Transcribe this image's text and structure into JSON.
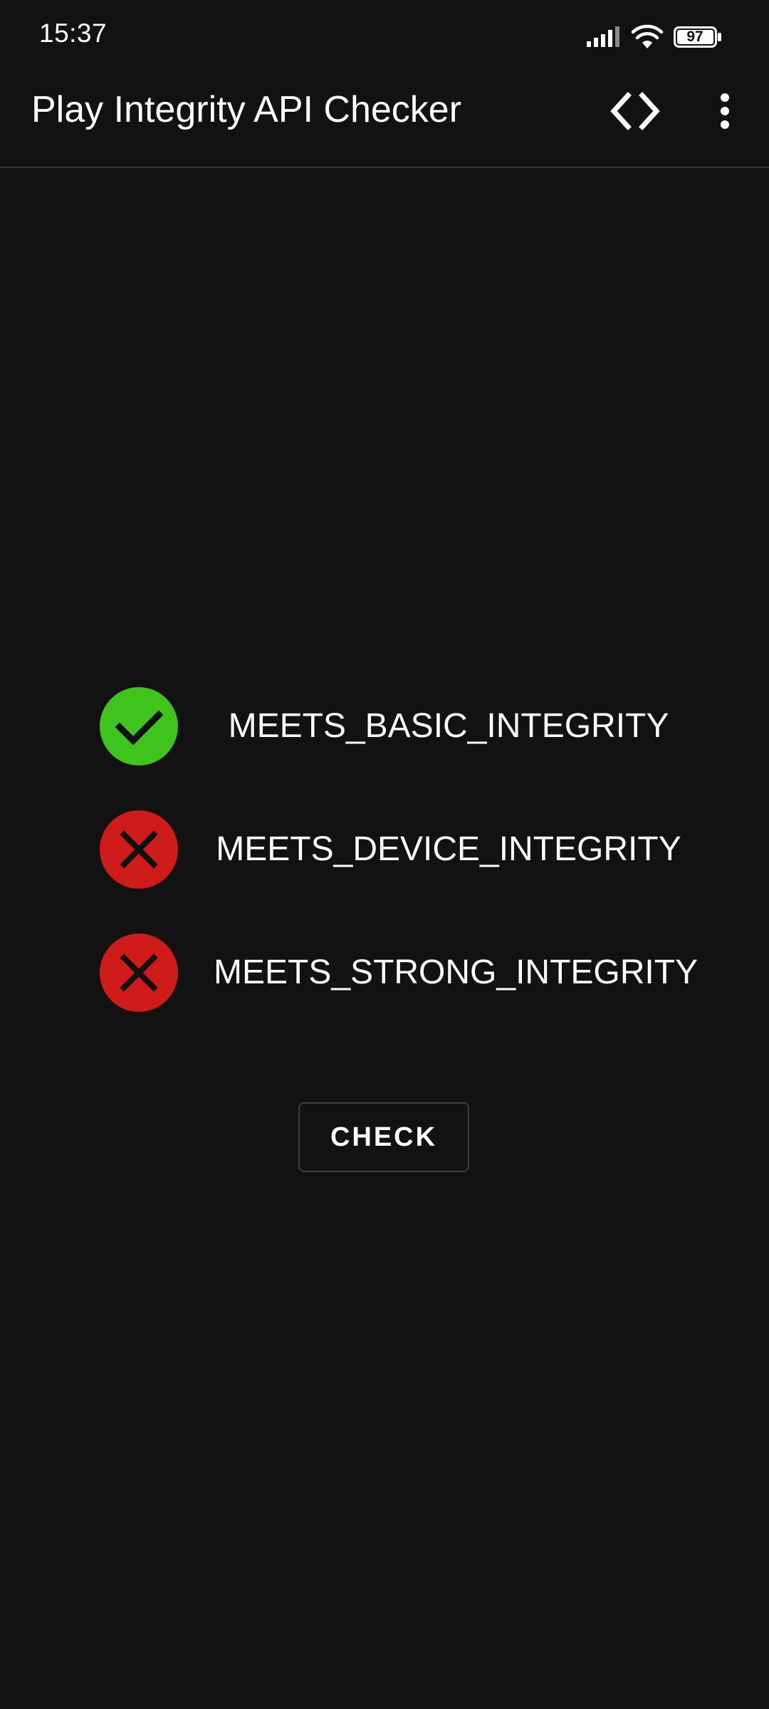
{
  "status_bar": {
    "time": "15:37",
    "battery_level": "97",
    "icons": [
      "signal-icon",
      "wifi-icon",
      "battery-icon"
    ]
  },
  "app_bar": {
    "title": "Play Integrity API Checker",
    "actions": [
      "code-icon",
      "more-vert-icon"
    ]
  },
  "results": [
    {
      "label": "MEETS_BASIC_INTEGRITY",
      "status": "pass",
      "icon": "check-icon",
      "color": "#3ec41c"
    },
    {
      "label": "MEETS_DEVICE_INTEGRITY",
      "status": "fail",
      "icon": "close-icon",
      "color": "#d01b1b"
    },
    {
      "label": "MEETS_STRONG_INTEGRITY",
      "status": "fail",
      "icon": "close-icon",
      "color": "#d01b1b"
    }
  ],
  "check_button": {
    "label": "CHECK"
  },
  "colors": {
    "background": "#121212",
    "divider": "#3a3a3a",
    "text": "#ffffff"
  }
}
